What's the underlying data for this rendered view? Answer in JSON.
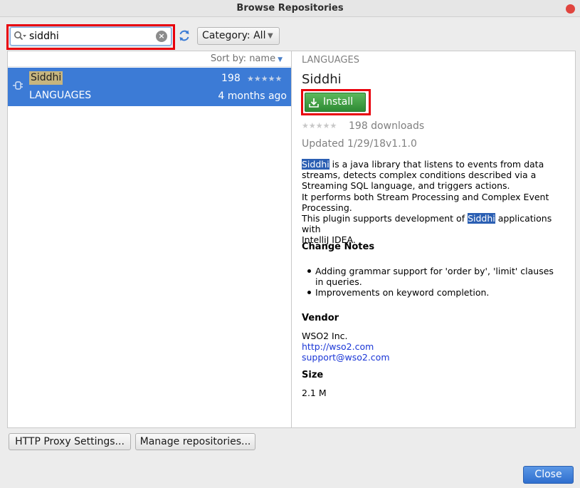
{
  "window": {
    "title": "Browse Repositories"
  },
  "search": {
    "value": "siddhi"
  },
  "category": {
    "label": "Category: All"
  },
  "list": {
    "sort_label": "Sort by: name",
    "items": [
      {
        "name": "Siddhi",
        "downloads": "198",
        "category": "LANGUAGES",
        "updated": "4 months ago"
      }
    ]
  },
  "detail": {
    "category": "LANGUAGES",
    "name": "Siddhi",
    "install_label": "Install",
    "downloads": "198 downloads",
    "updated": "Updated 1/29/18",
    "version": "v1.1.0",
    "desc": {
      "hl1": "Siddhi",
      "line1": " is a java library that listens to events from data",
      "line2": "streams, detects complex conditions described via a",
      "line3": "Streaming SQL language, and triggers actions.",
      "line4": "It performs both Stream Processing and Complex Event",
      "line5": "Processing.",
      "line6a": "This plugin supports development of ",
      "hl2": "Siddhi",
      "line6b": " applications with",
      "line7": "IntelliJ IDEA."
    },
    "change_notes_title": "Change Notes",
    "change_notes": [
      "Adding grammar support for 'order by', 'limit' clauses in queries.",
      "Improvements on keyword completion."
    ],
    "vendor_title": "Vendor",
    "vendor_name": "WSO2 Inc.",
    "vendor_url": "http://wso2.com",
    "vendor_email": "support@wso2.com",
    "size_title": "Size",
    "size_value": "2.1 M"
  },
  "footer": {
    "proxy_label": "HTTP Proxy Settings...",
    "manage_label": "Manage repositories...",
    "close_label": "Close"
  },
  "colors": {
    "accent": "#3c7bd6",
    "install_green": "#3a9a3f",
    "highlight_red": "#e8000b"
  }
}
